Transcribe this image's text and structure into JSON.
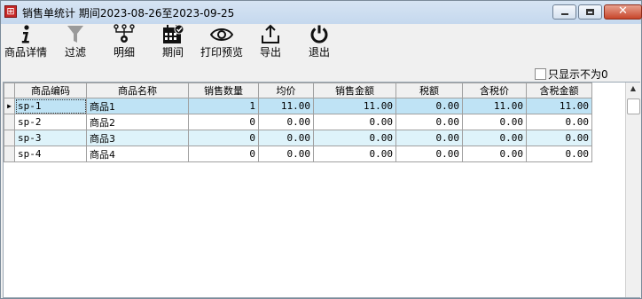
{
  "window": {
    "title": "销售单统计 期间2023-08-26至2023-09-25",
    "icon": "grid-app-icon"
  },
  "toolbar": {
    "items": [
      {
        "label": "商品详情",
        "icon": "info-icon"
      },
      {
        "label": "过滤",
        "icon": "filter-icon"
      },
      {
        "label": "明细",
        "icon": "detail-tree-icon"
      },
      {
        "label": "期间",
        "icon": "calendar-icon"
      },
      {
        "label": "打印预览",
        "icon": "eye-icon"
      },
      {
        "label": "导出",
        "icon": "export-icon"
      },
      {
        "label": "退出",
        "icon": "power-icon"
      }
    ]
  },
  "filter": {
    "only_nonzero_label": "只显示不为0",
    "checked": false
  },
  "grid": {
    "columns": [
      "商品编码",
      "商品名称",
      "销售数量",
      "均价",
      "销售金额",
      "税额",
      "含税价",
      "含税金额"
    ],
    "rows": [
      [
        "sp-1",
        "商品1",
        "1",
        "11.00",
        "11.00",
        "0.00",
        "11.00",
        "11.00"
      ],
      [
        "sp-2",
        "商品2",
        "0",
        "0.00",
        "0.00",
        "0.00",
        "0.00",
        "0.00"
      ],
      [
        "sp-3",
        "商品3",
        "0",
        "0.00",
        "0.00",
        "0.00",
        "0.00",
        "0.00"
      ],
      [
        "sp-4",
        "商品4",
        "0",
        "0.00",
        "0.00",
        "0.00",
        "0.00",
        "0.00"
      ]
    ],
    "selected_row_indicator": "▶"
  },
  "colors": {
    "selected_row": "#bfe3f5",
    "alt_row": "#def3fa",
    "title_bar": "#c5d8ee",
    "close_button": "#c7462b"
  }
}
